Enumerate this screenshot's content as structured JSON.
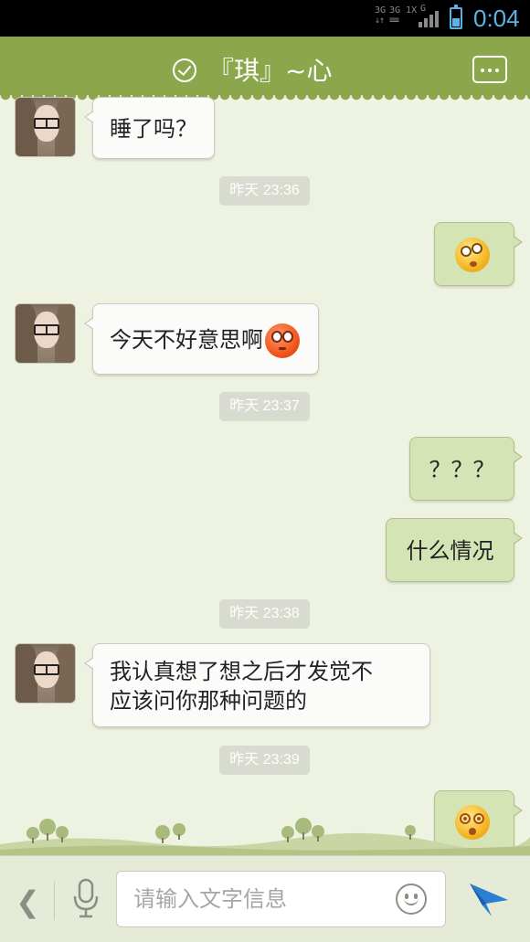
{
  "status_bar": {
    "network_1": "3G",
    "network_2": "3G 1X",
    "network_3": "G",
    "time": "0:04",
    "battery_level": 0.45
  },
  "header": {
    "title": "『琪』~心",
    "verified_icon": "check-circle-icon",
    "more_icon": "more-dots-icon"
  },
  "messages": [
    {
      "side": "in",
      "text": "睡了吗？"
    },
    {
      "time": "昨天 23:36"
    },
    {
      "side": "out",
      "emoji": "dizzy-face-emoji"
    },
    {
      "side": "in",
      "text": "今天不好意思啊",
      "emoji": "red-face-emoji"
    },
    {
      "time": "昨天 23:37"
    },
    {
      "side": "out",
      "text": "？？？"
    },
    {
      "side": "out",
      "text": "什么情况"
    },
    {
      "time": "昨天 23:38"
    },
    {
      "side": "in",
      "text_line_1": "我认真想了想之后才发觉不",
      "text_line_2": "应该问你那种问题的"
    },
    {
      "time": "昨天 23:39"
    },
    {
      "side": "out",
      "emoji": "spiral-eyes-emoji"
    }
  ],
  "input_bar": {
    "placeholder": "请输入文字信息",
    "value": "",
    "back_icon": "chevron-left-icon",
    "mic_icon": "microphone-icon",
    "emoji_icon": "smiley-icon",
    "send_icon": "send-arrow-icon"
  },
  "colors": {
    "header_bg": "#8ca64c",
    "chat_bg": "#eef2e0",
    "incoming_bubble": "#fbfbf9",
    "outgoing_bubble": "#d5e4b5",
    "status_accent": "#5ab4e6",
    "send_accent": "#2b7fd0"
  }
}
